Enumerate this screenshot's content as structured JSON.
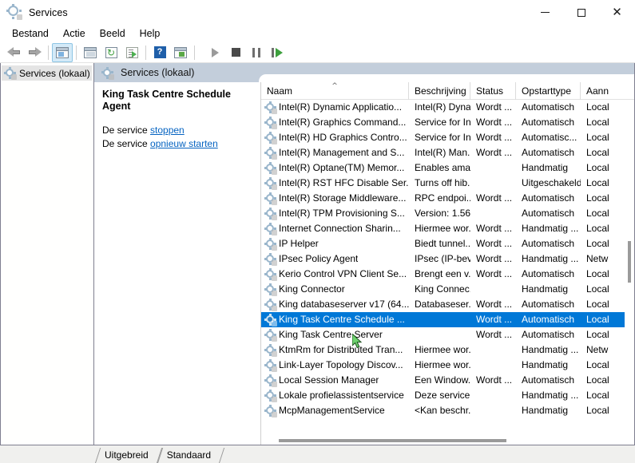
{
  "window": {
    "title": "Services",
    "icon": "services-gear-icon",
    "controls": {
      "minimize": "minimize",
      "maximize": "maximize",
      "close": "close"
    }
  },
  "menubar": {
    "items": [
      {
        "label": "Bestand",
        "name": "menu-bestand"
      },
      {
        "label": "Actie",
        "name": "menu-actie"
      },
      {
        "label": "Beeld",
        "name": "menu-beeld"
      },
      {
        "label": "Help",
        "name": "menu-help"
      }
    ]
  },
  "toolbar": {
    "buttons": [
      {
        "name": "back-arrow-icon"
      },
      {
        "name": "forward-arrow-icon"
      },
      {
        "name": "show-hide-console-tree-icon"
      },
      {
        "name": "properties-icon"
      },
      {
        "name": "refresh-icon"
      },
      {
        "name": "export-list-icon"
      },
      {
        "name": "help-icon"
      },
      {
        "name": "show-hide-action-pane-icon"
      },
      {
        "name": "start-service-icon"
      },
      {
        "name": "stop-service-icon"
      },
      {
        "name": "pause-service-icon"
      },
      {
        "name": "restart-service-icon"
      }
    ]
  },
  "tree": {
    "root_label": "Services (lokaal)"
  },
  "content_header": {
    "title": "Services (lokaal)"
  },
  "detail": {
    "service_title": "King Task Centre Schedule Agent",
    "stop_prefix": "De service ",
    "stop_link": "stoppen",
    "restart_prefix": "De service ",
    "restart_link": "opnieuw starten"
  },
  "list": {
    "sort_column": "Naam",
    "sort_direction": "ascending",
    "columns": [
      {
        "label": "Naam",
        "name": "column-header-naam"
      },
      {
        "label": "Beschrijving",
        "name": "column-header-beschrijving"
      },
      {
        "label": "Status",
        "name": "column-header-status"
      },
      {
        "label": "Opstarttype",
        "name": "column-header-opstarttype"
      },
      {
        "label": "Aann",
        "name": "column-header-aanmelden-als"
      }
    ],
    "rows": [
      {
        "name": "Intel(R) Dynamic Applicatio...",
        "desc": "Intel(R) Dyna...",
        "status": "Wordt ...",
        "startup": "Automatisch",
        "logon": "Local",
        "selected": false
      },
      {
        "name": "Intel(R) Graphics Command...",
        "desc": "Service for In...",
        "status": "Wordt ...",
        "startup": "Automatisch",
        "logon": "Local",
        "selected": false
      },
      {
        "name": "Intel(R) HD Graphics Contro...",
        "desc": "Service for In...",
        "status": "Wordt ...",
        "startup": "Automatisc...",
        "logon": "Local",
        "selected": false
      },
      {
        "name": "Intel(R) Management and S...",
        "desc": "Intel(R) Man...",
        "status": "Wordt ...",
        "startup": "Automatisch",
        "logon": "Local",
        "selected": false
      },
      {
        "name": "Intel(R) Optane(TM) Memor...",
        "desc": "Enables ama...",
        "status": "",
        "startup": "Handmatig",
        "logon": "Local",
        "selected": false
      },
      {
        "name": "Intel(R) RST HFC Disable Ser...",
        "desc": "Turns off hib...",
        "status": "",
        "startup": "Uitgeschakeld",
        "logon": "Local",
        "selected": false
      },
      {
        "name": "Intel(R) Storage Middleware...",
        "desc": "RPC endpoi...",
        "status": "Wordt ...",
        "startup": "Automatisch",
        "logon": "Local",
        "selected": false
      },
      {
        "name": "Intel(R) TPM Provisioning S...",
        "desc": "Version: 1.56...",
        "status": "",
        "startup": "Automatisch",
        "logon": "Local",
        "selected": false
      },
      {
        "name": "Internet Connection Sharin...",
        "desc": "Hiermee wor...",
        "status": "Wordt ...",
        "startup": "Handmatig ...",
        "logon": "Local",
        "selected": false
      },
      {
        "name": "IP Helper",
        "desc": "Biedt tunnel...",
        "status": "Wordt ...",
        "startup": "Automatisch",
        "logon": "Local",
        "selected": false
      },
      {
        "name": "IPsec Policy Agent",
        "desc": "IPsec (IP-bev...",
        "status": "Wordt ...",
        "startup": "Handmatig ...",
        "logon": "Netw",
        "selected": false
      },
      {
        "name": "Kerio Control VPN Client Se...",
        "desc": "Brengt een v...",
        "status": "Wordt ...",
        "startup": "Automatisch",
        "logon": "Local",
        "selected": false
      },
      {
        "name": "King Connector",
        "desc": "King Connec...",
        "status": "",
        "startup": "Handmatig",
        "logon": "Local",
        "selected": false
      },
      {
        "name": "King databaseserver v17 (64...",
        "desc": "Databaseser...",
        "status": "Wordt ...",
        "startup": "Automatisch",
        "logon": "Local",
        "selected": false
      },
      {
        "name": "King Task Centre Schedule ...",
        "desc": "",
        "status": "Wordt ...",
        "startup": "Automatisch",
        "logon": "Local",
        "selected": true
      },
      {
        "name": "King Task Centre Server",
        "desc": "",
        "status": "Wordt ...",
        "startup": "Automatisch",
        "logon": "Local",
        "selected": false
      },
      {
        "name": "KtmRm for Distributed Tran...",
        "desc": "Hiermee wor...",
        "status": "",
        "startup": "Handmatig ...",
        "logon": "Netw",
        "selected": false
      },
      {
        "name": "Link-Layer Topology Discov...",
        "desc": "Hiermee wor...",
        "status": "",
        "startup": "Handmatig",
        "logon": "Local",
        "selected": false
      },
      {
        "name": "Local Session Manager",
        "desc": "Een Window...",
        "status": "Wordt ...",
        "startup": "Automatisch",
        "logon": "Local",
        "selected": false
      },
      {
        "name": "Lokale profielassistentservice",
        "desc": "Deze service ...",
        "status": "",
        "startup": "Handmatig ...",
        "logon": "Local",
        "selected": false
      },
      {
        "name": "McpManagementService",
        "desc": "<Kan beschr...",
        "status": "",
        "startup": "Handmatig",
        "logon": "Local",
        "selected": false
      }
    ]
  },
  "tabs": [
    {
      "label": "Uitgebreid",
      "name": "tab-uitgebreid",
      "active": false
    },
    {
      "label": "Standaard",
      "name": "tab-standaard",
      "active": true
    }
  ],
  "colors": {
    "selection": "#0078d7",
    "link": "#0563c1",
    "header_band": "#c3cedb",
    "window_bg": "#f0f0ee"
  }
}
